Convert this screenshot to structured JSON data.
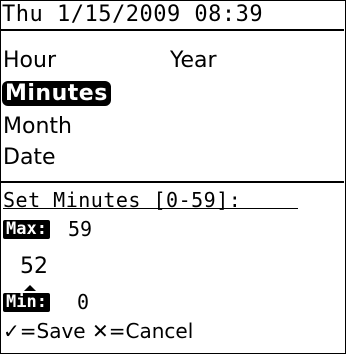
{
  "header": {
    "datetime": "Thu 1/15/2009 08:39"
  },
  "menu": {
    "hour": "Hour",
    "year": "Year",
    "minutes": "Minutes",
    "month": "Month",
    "date": "Date"
  },
  "editor": {
    "prompt": "Set Minutes [0-59]:",
    "max_label": "Max:",
    "max_value": "59",
    "current_value": "52",
    "min_label": "Min:",
    "min_value": "0"
  },
  "footer": {
    "save_glyph": "✓",
    "save_label": "=Save",
    "cancel_glyph": "✕",
    "cancel_label": "=Cancel"
  }
}
